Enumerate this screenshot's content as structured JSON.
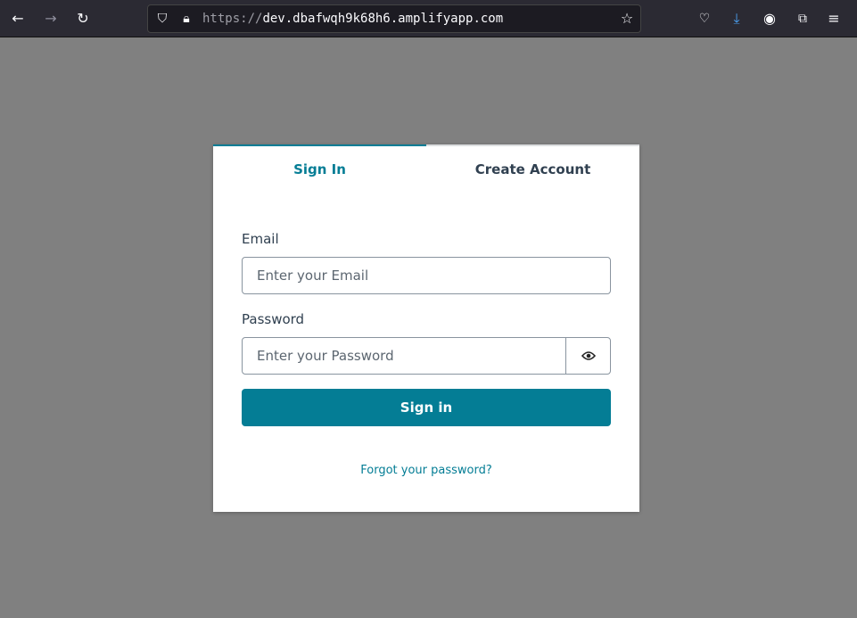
{
  "browser": {
    "url_scheme": "https://",
    "url_host": "dev.dbafwqh9k68h6.amplifyapp.com",
    "icons": [
      "back-icon",
      "forward-icon",
      "reload-icon",
      "shield-icon",
      "lock-icon",
      "star-icon",
      "pocket-icon",
      "download-icon",
      "account-icon",
      "extensions-icon",
      "menu-icon"
    ]
  },
  "auth": {
    "tabs": [
      {
        "label": "Sign In",
        "active": true
      },
      {
        "label": "Create Account",
        "active": false
      }
    ],
    "email_label": "Email",
    "email_placeholder": "Enter your Email",
    "password_label": "Password",
    "password_placeholder": "Enter your Password",
    "submit_label": "Sign in",
    "forgot_label": "Forgot your password?"
  },
  "colors": {
    "accent": "#047d95",
    "text": "#304050",
    "backdrop": "#808080"
  }
}
